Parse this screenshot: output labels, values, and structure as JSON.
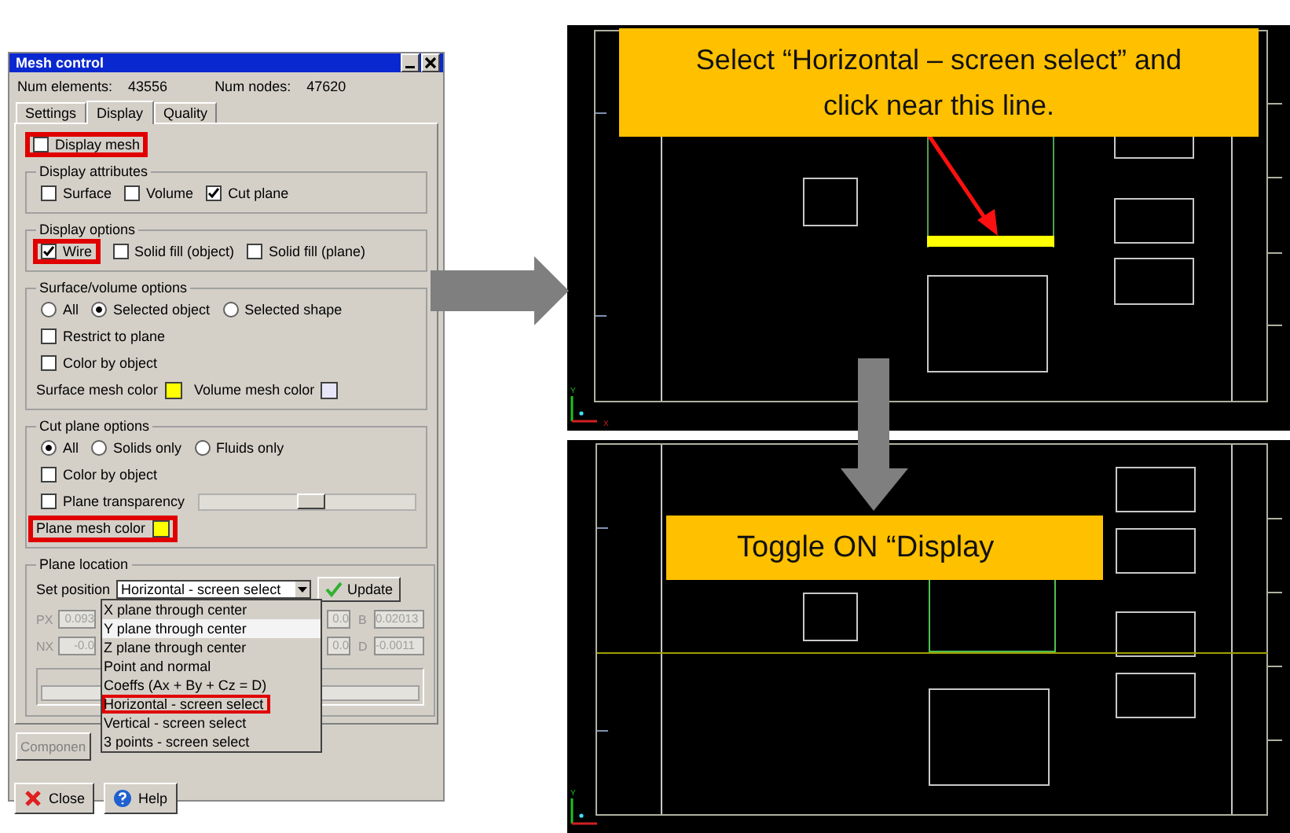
{
  "dialog": {
    "title": "Mesh control",
    "stats": [
      {
        "label": "Num elements:",
        "value": "43556"
      },
      {
        "label": "Num nodes:",
        "value": "47620"
      }
    ],
    "tabs": [
      {
        "label": "Settings",
        "selected": false
      },
      {
        "label": "Display",
        "selected": true
      },
      {
        "label": "Quality",
        "selected": false
      }
    ],
    "display_mesh": {
      "label": "Display mesh",
      "checked": false,
      "highlighted": true
    },
    "groups": [
      {
        "title": "Display attributes",
        "rows": [
          [
            {
              "kind": "checkbox",
              "label": "Surface",
              "checked": false,
              "highlighted": false
            },
            {
              "kind": "checkbox",
              "label": "Volume",
              "checked": false,
              "highlighted": false
            },
            {
              "kind": "checkbox",
              "label": "Cut plane",
              "checked": true,
              "highlighted": false
            }
          ]
        ]
      },
      {
        "title": "Display options",
        "rows": [
          [
            {
              "kind": "checkbox",
              "label": "Wire",
              "checked": true,
              "highlighted": true
            },
            {
              "kind": "checkbox",
              "label": "Solid fill (object)",
              "checked": false,
              "highlighted": false
            },
            {
              "kind": "checkbox",
              "label": "Solid fill (plane)",
              "checked": false,
              "highlighted": false
            }
          ]
        ]
      },
      {
        "title": "Surface/volume options",
        "rows": [
          [
            {
              "kind": "radio",
              "label": "All",
              "selected": false,
              "highlighted": false
            },
            {
              "kind": "radio",
              "label": "Selected object",
              "selected": true,
              "highlighted": false
            },
            {
              "kind": "radio",
              "label": "Selected shape",
              "selected": false,
              "highlighted": false
            }
          ],
          [
            {
              "kind": "checkbox",
              "label": "Restrict to plane",
              "checked": false,
              "highlighted": false
            }
          ],
          [
            {
              "kind": "checkbox",
              "label": "Color by object",
              "checked": false,
              "highlighted": false
            }
          ],
          [
            {
              "kind": "color",
              "label": "Surface mesh color",
              "color": "#ffff00",
              "highlighted": false
            },
            {
              "kind": "color",
              "label": "Volume mesh color",
              "color": "#e6e6f8",
              "highlighted": false
            }
          ]
        ]
      },
      {
        "title": "Cut plane options",
        "rows": [
          [
            {
              "kind": "radio",
              "label": "All",
              "selected": true,
              "highlighted": false
            },
            {
              "kind": "radio",
              "label": "Solids only",
              "selected": false,
              "highlighted": false
            },
            {
              "kind": "radio",
              "label": "Fluids only",
              "selected": false,
              "highlighted": false
            }
          ],
          [
            {
              "kind": "checkbox",
              "label": "Color by object",
              "checked": false,
              "highlighted": false
            }
          ],
          [
            {
              "kind": "checkbox",
              "label": "Plane transparency",
              "checked": false,
              "highlighted": false
            },
            {
              "kind": "slider",
              "level": 0.52
            }
          ],
          [
            {
              "kind": "color",
              "label": "Plane mesh color",
              "color": "#ffff00",
              "highlighted": true
            }
          ]
        ]
      }
    ],
    "plane_location": {
      "title": "Plane location",
      "set_label": "Set position",
      "combo_value": "Horizontal - screen select",
      "update": "Update",
      "coords": [
        {
          "label": "PX",
          "value_1": "0.093",
          "value_2": "0.0",
          "label_2": "B",
          "value_3": "0.02013"
        },
        {
          "label": "NX",
          "value_1": "-0.0",
          "value_2": "0.0",
          "label_2": "D",
          "value_3": "-0.0011"
        }
      ],
      "options": [
        {
          "label": "X plane through center",
          "selected": false,
          "highlighted": false
        },
        {
          "label": "Y plane through center",
          "selected": true,
          "highlighted": false
        },
        {
          "label": "Z plane through center",
          "selected": false,
          "highlighted": false
        },
        {
          "label": "Point and normal",
          "selected": false,
          "highlighted": false
        },
        {
          "label": "Coeffs (Ax + By + Cz = D)",
          "selected": false,
          "highlighted": false
        },
        {
          "label": "Horizontal - screen select",
          "selected": false,
          "highlighted": true
        },
        {
          "label": "Vertical - screen select",
          "selected": false,
          "highlighted": false
        },
        {
          "label": "3 points - screen select",
          "selected": false,
          "highlighted": false
        }
      ]
    },
    "component_button": "Componen",
    "buttons": [
      {
        "kind": "close",
        "label": "Close"
      },
      {
        "kind": "help",
        "label": "Help"
      }
    ]
  },
  "views": [
    {
      "callout": "Select “Horizontal – screen select” and click near this line.",
      "axes": [
        "Y",
        "X"
      ]
    },
    {
      "callout": "Toggle ON “Display",
      "axes": [
        "Y"
      ]
    }
  ]
}
